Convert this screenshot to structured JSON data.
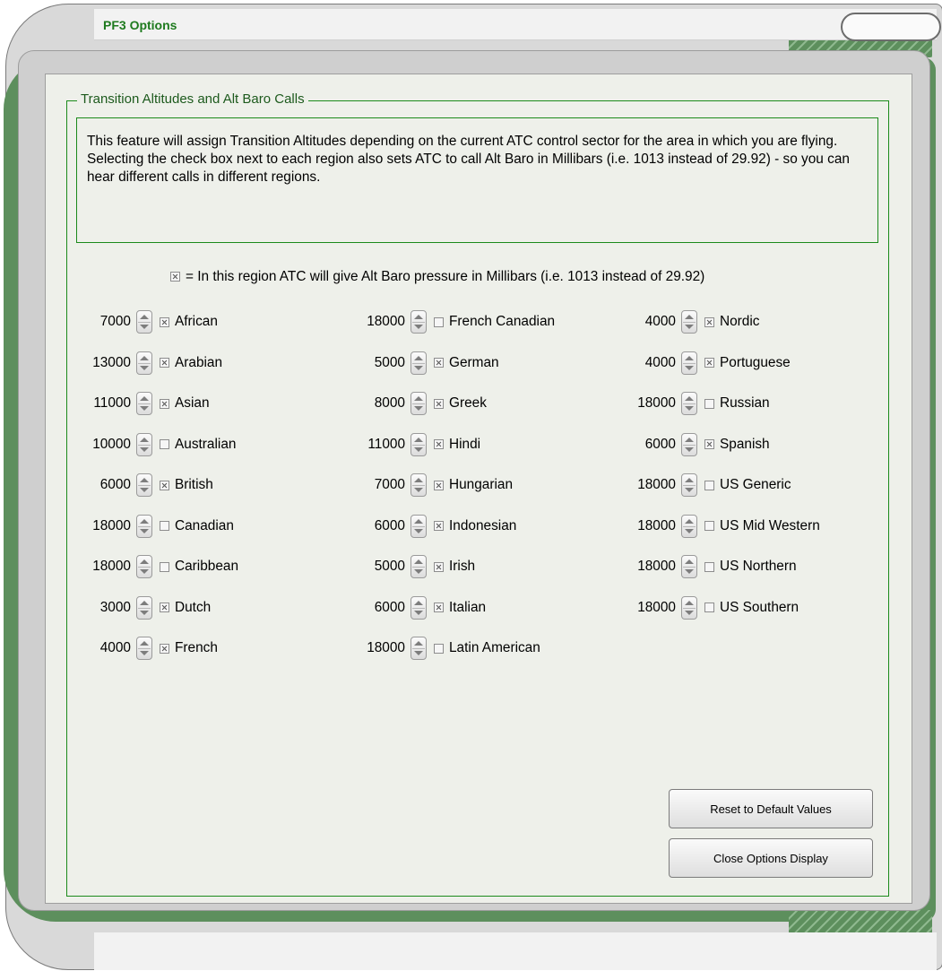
{
  "window": {
    "title": "PF3 Options"
  },
  "group": {
    "title": "Transition Altitudes and Alt Baro Calls",
    "description": "This feature will assign Transition Altitudes depending on the current ATC control sector for the area in which you are flying. Selecting the check box next to each region also sets ATC to call Alt Baro in Millibars (i.e. 1013 instead of 29.92) - so you can hear different calls in different regions.",
    "legend": "= In this region ATC will give Alt Baro pressure in Millibars (i.e. 1013 instead of 29.92)"
  },
  "columns": [
    {
      "regions": [
        {
          "altitude": "7000",
          "checked": true,
          "name": "African"
        },
        {
          "altitude": "13000",
          "checked": true,
          "name": "Arabian"
        },
        {
          "altitude": "11000",
          "checked": true,
          "name": "Asian"
        },
        {
          "altitude": "10000",
          "checked": false,
          "name": "Australian"
        },
        {
          "altitude": "6000",
          "checked": true,
          "name": "British"
        },
        {
          "altitude": "18000",
          "checked": false,
          "name": "Canadian"
        },
        {
          "altitude": "18000",
          "checked": false,
          "name": "Caribbean"
        },
        {
          "altitude": "3000",
          "checked": true,
          "name": "Dutch"
        },
        {
          "altitude": "4000",
          "checked": true,
          "name": "French"
        }
      ]
    },
    {
      "regions": [
        {
          "altitude": "18000",
          "checked": false,
          "name": "French Canadian"
        },
        {
          "altitude": "5000",
          "checked": true,
          "name": "German"
        },
        {
          "altitude": "8000",
          "checked": true,
          "name": "Greek"
        },
        {
          "altitude": "11000",
          "checked": true,
          "name": "Hindi"
        },
        {
          "altitude": "7000",
          "checked": true,
          "name": "Hungarian"
        },
        {
          "altitude": "6000",
          "checked": true,
          "name": "Indonesian"
        },
        {
          "altitude": "5000",
          "checked": true,
          "name": "Irish"
        },
        {
          "altitude": "6000",
          "checked": true,
          "name": "Italian"
        },
        {
          "altitude": "18000",
          "checked": false,
          "name": "Latin American"
        }
      ]
    },
    {
      "regions": [
        {
          "altitude": "4000",
          "checked": true,
          "name": "Nordic"
        },
        {
          "altitude": "4000",
          "checked": true,
          "name": "Portuguese"
        },
        {
          "altitude": "18000",
          "checked": false,
          "name": "Russian"
        },
        {
          "altitude": "6000",
          "checked": true,
          "name": "Spanish"
        },
        {
          "altitude": "18000",
          "checked": false,
          "name": "US Generic"
        },
        {
          "altitude": "18000",
          "checked": false,
          "name": "US Mid Western"
        },
        {
          "altitude": "18000",
          "checked": false,
          "name": "US Northern"
        },
        {
          "altitude": "18000",
          "checked": false,
          "name": "US Southern"
        }
      ]
    }
  ],
  "buttons": {
    "reset": "Reset to Default Values",
    "close": "Close Options Display"
  }
}
